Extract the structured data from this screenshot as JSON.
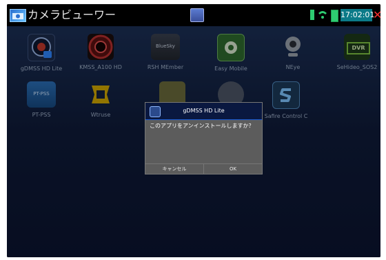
{
  "statusbar": {
    "title": "カメラビューワー",
    "time": "17:02:01",
    "close_glyph": "✕"
  },
  "apps": [
    {
      "label": "gDMSS HD Lite",
      "icon": "gdmss-hd-icon"
    },
    {
      "label": "KMSS_A100 HD",
      "icon": "camera-lens-icon"
    },
    {
      "label": "RSH MEmber",
      "icon": "bluesky-icon"
    },
    {
      "label": "Easy Mobile",
      "icon": "green-camera-icon"
    },
    {
      "label": "NEye",
      "icon": "webcam-icon"
    },
    {
      "label": "SeHideo_SOS2",
      "icon": "dvr-icon"
    },
    {
      "label": "PT-PSS",
      "icon": "ptpss-icon"
    },
    {
      "label": "Wtruse",
      "icon": "yellow-frame-icon"
    },
    {
      "label": "",
      "icon": "hidden-app-icon"
    },
    {
      "label": "",
      "icon": "hidden-app-icon-2"
    },
    {
      "label": "Safire Control C",
      "icon": "s-logo-icon"
    }
  ],
  "dialog": {
    "title": "gDMSS HD Lite",
    "message": "このアプリをアンインストールしますか？",
    "cancel_label": "キャンセル",
    "ok_label": "OK"
  },
  "icons": {
    "bluesky_text": "BlueSky",
    "dvr_text": "DVR",
    "ptpss_text": "PT-PSS"
  },
  "colors": {
    "desktop_top": "#1b2f55",
    "clock_bg": "#0b7a88",
    "close": "#ff3030"
  }
}
